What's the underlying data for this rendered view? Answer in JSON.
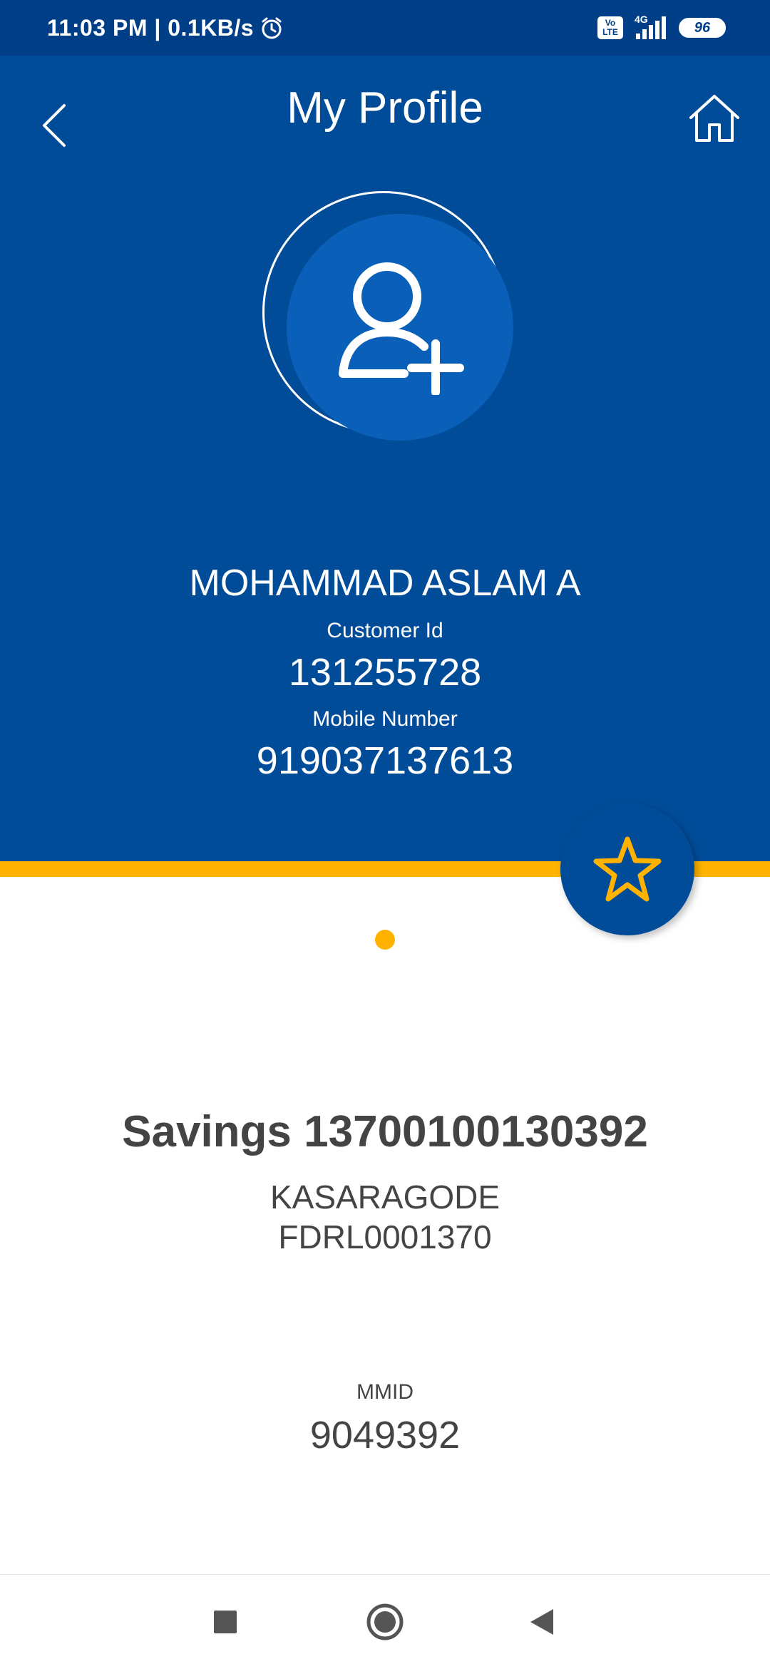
{
  "status_bar": {
    "time_speed": "11:03 PM | 0.1KB/s",
    "volte_label": "Vo\nLTE",
    "network_type": "4G",
    "battery_level": "96",
    "icons": [
      "alarm-icon",
      "volte-icon",
      "signal-icon",
      "battery-icon"
    ]
  },
  "header": {
    "title": "My Profile",
    "icons": [
      "back-arrow-icon",
      "home-icon",
      "add-user-icon"
    ]
  },
  "profile": {
    "name": "MOHAMMAD ASLAM A",
    "customer_id_label": "Customer Id",
    "customer_id": "131255728",
    "mobile_label": "Mobile Number",
    "mobile": "919037137613"
  },
  "favorite": {
    "icon": "star-icon"
  },
  "account": {
    "title": "Savings 13700100130392",
    "branch": "KASARAGODE",
    "ifsc": "FDRL0001370",
    "mmid_label": "MMID",
    "mmid": "9049392"
  },
  "nav_bar": {
    "icons": [
      "recents-square-icon",
      "home-circle-icon",
      "back-triangle-icon"
    ]
  },
  "colors": {
    "primary": "#004c99",
    "status_bar": "#003f87",
    "accent": "#ffb300",
    "text_dark": "#444444"
  }
}
